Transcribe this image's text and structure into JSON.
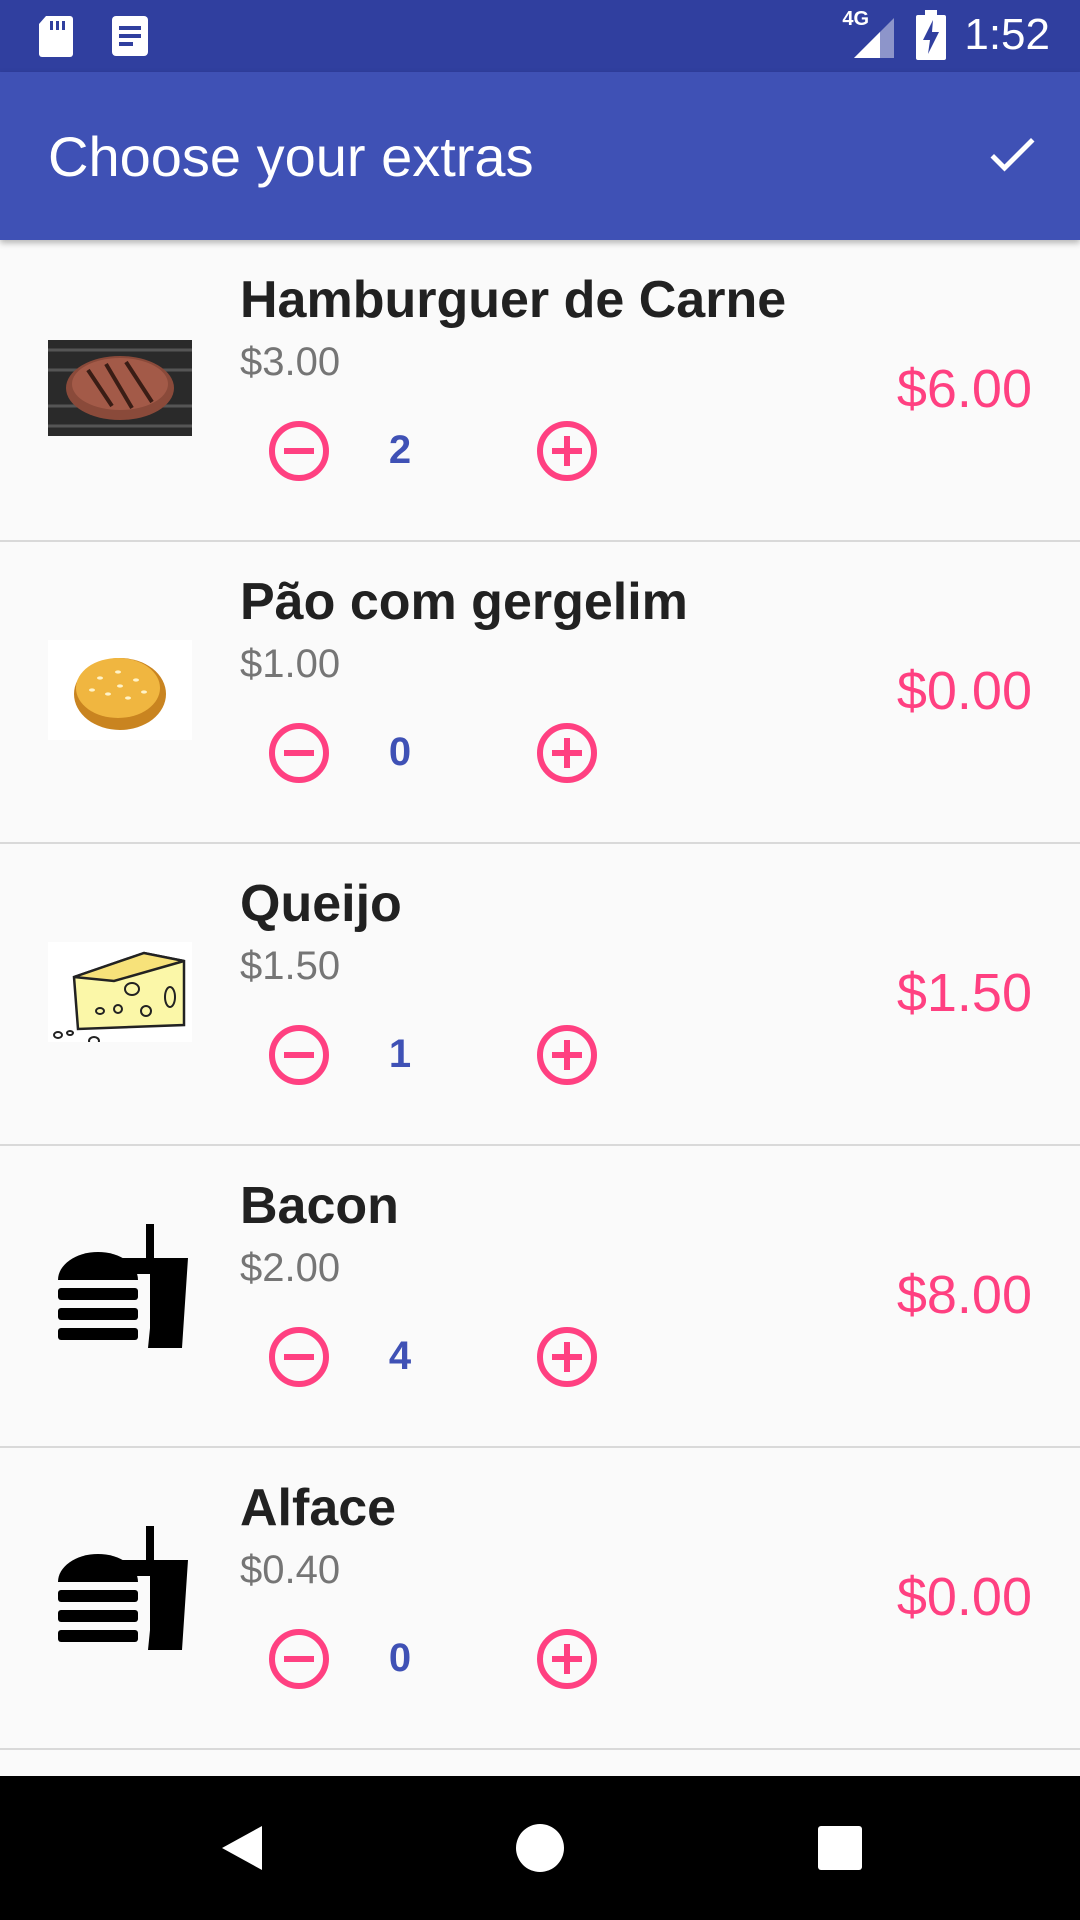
{
  "status_bar": {
    "time": "1:52",
    "network": "4G",
    "icons": [
      "sd-card-icon",
      "notification-doc-icon",
      "signal-icon",
      "battery-charging-icon"
    ]
  },
  "app_bar": {
    "title": "Choose your extras",
    "action_icon": "check-icon"
  },
  "colors": {
    "primary": "#3f51b5",
    "primary_dark": "#303f9f",
    "accent": "#ff4081"
  },
  "extras": [
    {
      "name": "Hamburguer de Carne",
      "unit_price": "$3.00",
      "quantity": "2",
      "total": "$6.00",
      "image": "beef-patty-photo"
    },
    {
      "name": "Pão com gergelim",
      "unit_price": "$1.00",
      "quantity": "0",
      "total": "$0.00",
      "image": "sesame-bun-photo"
    },
    {
      "name": "Queijo",
      "unit_price": "$1.50",
      "quantity": "1",
      "total": "$1.50",
      "image": "cheese-drawing"
    },
    {
      "name": "Bacon",
      "unit_price": "$2.00",
      "quantity": "4",
      "total": "$8.00",
      "image": "fastfood-icon"
    },
    {
      "name": "Alface",
      "unit_price": "$0.40",
      "quantity": "0",
      "total": "$0.00",
      "image": "fastfood-icon"
    }
  ],
  "nav_bar": {
    "icons": [
      "back-icon",
      "home-icon",
      "recents-icon"
    ]
  }
}
